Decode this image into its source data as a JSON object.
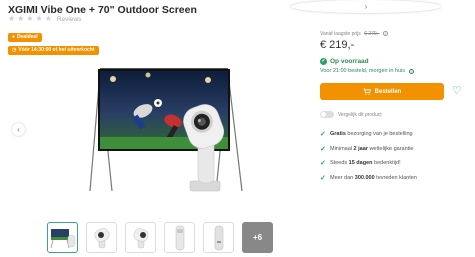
{
  "product": {
    "title": "XGIMI Vibe One + 70\" Outdoor Screen",
    "reviews_label": "Reviews",
    "stars": 0
  },
  "badges": {
    "deal": "Dealdeal",
    "deadline": "Vóór 14:30:00 of het uitverkocht"
  },
  "pricing": {
    "old_prefix": "Vanaf laagste prijs",
    "old_price": "€ 279,-",
    "price": "€ 219,-"
  },
  "stock": {
    "status": "Op voorraad",
    "delivery": "Voor 21:00 besteld, morgen in huis"
  },
  "actions": {
    "order": "Bestellen",
    "compare": "Vergelijk dit product"
  },
  "usps": [
    {
      "bold": "Gratis",
      "text": " bezorging van je bestelling"
    },
    {
      "prefix": "Minimaal ",
      "bold": "2 jaar",
      "text": " wettelijke garantie"
    },
    {
      "prefix": "Steeds ",
      "bold": "15 dagen",
      "text": " bedenktijd!"
    },
    {
      "prefix": "Meer dan ",
      "bold": "300.000",
      "text": " tevreden klanten"
    }
  ],
  "thumbnails": {
    "more": "+6"
  },
  "colors": {
    "accent_orange": "#f39200",
    "green": "#2e9e64",
    "teal": "#3aa68a"
  }
}
